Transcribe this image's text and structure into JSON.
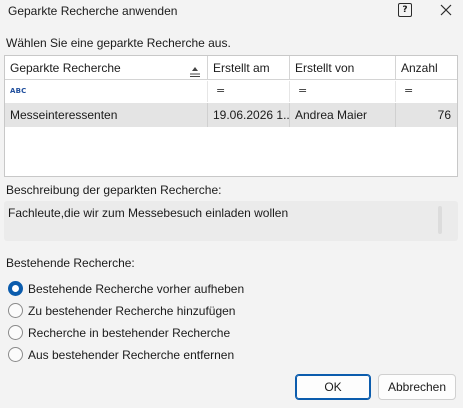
{
  "window": {
    "title": "Geparkte Recherche anwenden",
    "help_glyph": "?"
  },
  "instruction": "Wählen Sie eine geparkte Recherche aus.",
  "grid": {
    "columns": [
      "Geparkte Recherche",
      "Erstellt am",
      "Erstellt von",
      "Anzahl"
    ],
    "filter_glyph": "=",
    "filter_text_icon": "ABC",
    "rows": [
      {
        "name": "Messeinteressenten",
        "created_on": "19.06.2026 1...",
        "created_by": "Andrea Maier",
        "count": "76"
      }
    ]
  },
  "description": {
    "label": "Beschreibung der geparkten Recherche:",
    "text": "Fachleute,die wir zum Messebesuch einladen wollen"
  },
  "existing": {
    "label": "Bestehende Recherche:",
    "options": [
      "Bestehende Recherche vorher aufheben",
      "Zu bestehender Recherche hinzufügen",
      "Recherche in bestehender Recherche",
      "Aus bestehender Recherche entfernen"
    ],
    "selected_index": 0
  },
  "buttons": {
    "ok": "OK",
    "cancel": "Abbrechen"
  },
  "colors": {
    "accent": "#0b5cad",
    "selected_row": "#e4e4e4",
    "dialog_bg": "#f3f3f3"
  }
}
